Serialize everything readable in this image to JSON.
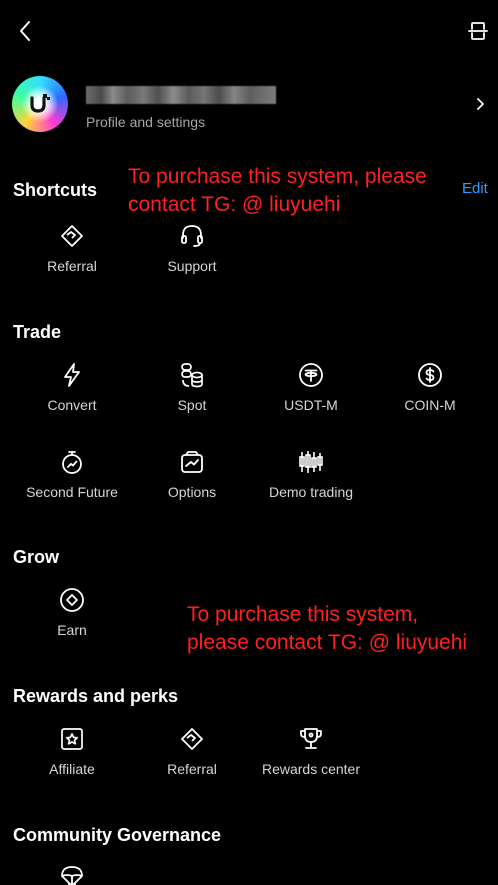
{
  "profile": {
    "subtitle": "Profile and settings"
  },
  "promo": {
    "top": [
      "To purchase this system, please",
      "contact TG: @ liuyuehi"
    ],
    "bottom": [
      "To purchase this system,",
      "please contact TG: @ liuyuehi"
    ]
  },
  "shortcuts": {
    "title": "Shortcuts",
    "edit_label": "Edit",
    "items": [
      {
        "label": "Referral",
        "icon": "handshake-icon"
      },
      {
        "label": "Support",
        "icon": "headset-icon"
      }
    ]
  },
  "trade": {
    "title": "Trade",
    "items": [
      {
        "label": "Convert",
        "icon": "lightning-icon"
      },
      {
        "label": "Spot",
        "icon": "coins-stack-icon"
      },
      {
        "label": "USDT-M",
        "icon": "tether-icon"
      },
      {
        "label": "COIN-M",
        "icon": "dollar-coin-icon"
      },
      {
        "label": "Second Future",
        "icon": "stopwatch-icon"
      },
      {
        "label": "Options",
        "icon": "options-icon"
      },
      {
        "label": "Demo trading",
        "icon": "candlestick-icon"
      }
    ]
  },
  "grow": {
    "title": "Grow",
    "items": [
      {
        "label": "Earn",
        "icon": "earn-icon"
      }
    ]
  },
  "rewards": {
    "title": "Rewards and perks",
    "items": [
      {
        "label": "Affiliate",
        "icon": "star-badge-icon"
      },
      {
        "label": "Referral",
        "icon": "handshake-icon"
      },
      {
        "label": "Rewards center",
        "icon": "trophy-icon"
      }
    ]
  },
  "community": {
    "title": "Community Governance"
  },
  "colors": {
    "background": "#000000",
    "accent": "#2f9cff",
    "promo": "#ff2020",
    "muted": "#a6a6a6"
  }
}
